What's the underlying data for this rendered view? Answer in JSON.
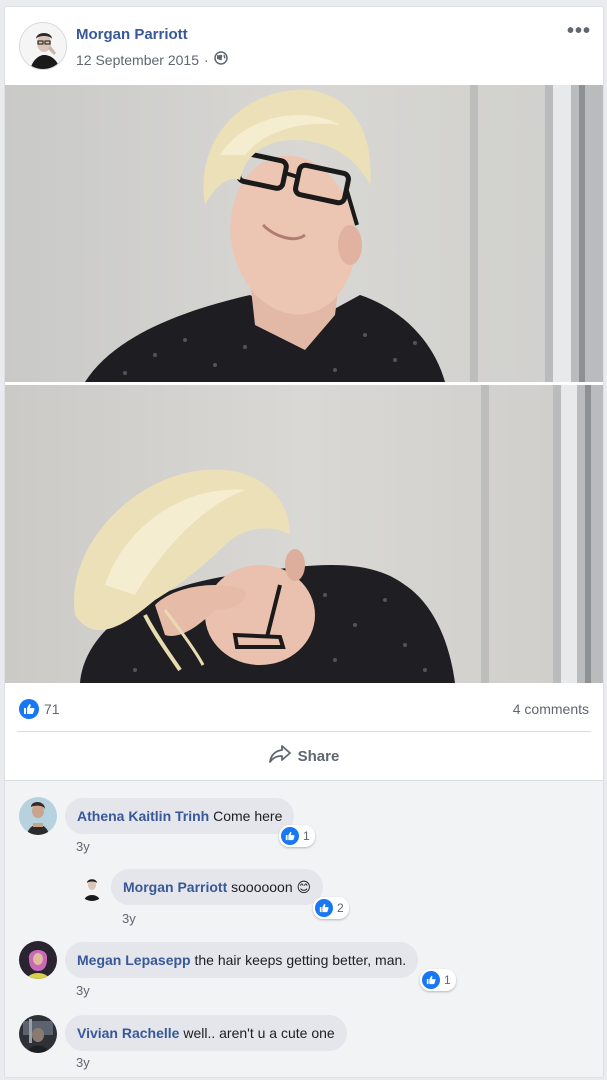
{
  "post": {
    "author": "Morgan Parriott",
    "date": "12 September 2015",
    "separator": "·",
    "privacy_icon": "globe-icon",
    "more_icon": "more-options-icon",
    "photos": [
      {
        "alt": "blonde young man with black glasses and dark patterned shirt smiling"
      },
      {
        "alt": "blonde young man with glasses looking down holding his hair"
      }
    ]
  },
  "reactions": {
    "likes": "71",
    "like_icon": "like-icon",
    "comments": "4 comments"
  },
  "actions": {
    "share_label": "Share",
    "share_icon": "share-icon"
  },
  "comments": [
    {
      "name": "Athena Kaitlin Trinh",
      "text": "Come here",
      "time": "3y",
      "likes": "1",
      "reply": false
    },
    {
      "name": "Morgan Parriott",
      "text": "soooooon",
      "emoji": "😊",
      "time": "3y",
      "likes": "2",
      "reply": true
    },
    {
      "name": "Megan Lepasepp",
      "text": "the hair keeps getting better, man.",
      "time": "3y",
      "likes": "1",
      "reply": false
    },
    {
      "name": "Vivian Rachelle",
      "text": "well.. aren't u a cute one",
      "time": "3y",
      "reply": false
    }
  ],
  "colors": {
    "link_blue": "#385898",
    "like_blue": "#1877f2",
    "secondary_text": "#606770",
    "bubble_bg": "#e4e6eb"
  }
}
